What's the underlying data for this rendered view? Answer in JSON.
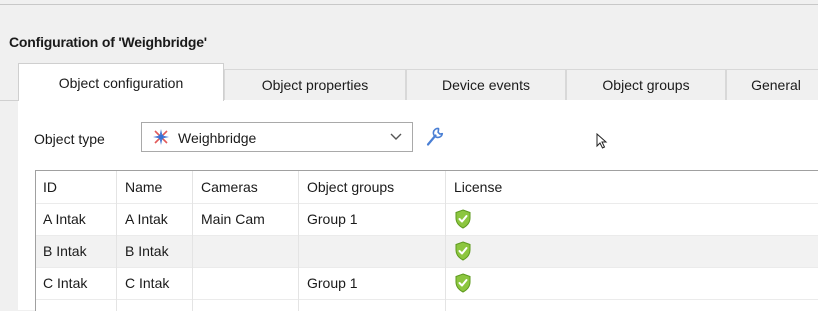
{
  "panel": {
    "title": "Configuration of 'Weighbridge'"
  },
  "tabs": [
    {
      "label": "Object configuration",
      "active": true
    },
    {
      "label": "Object properties",
      "active": false
    },
    {
      "label": "Device events",
      "active": false
    },
    {
      "label": "Object groups",
      "active": false
    },
    {
      "label": "General",
      "active": false
    }
  ],
  "object_type": {
    "label": "Object type",
    "value": "Weighbridge",
    "icon": "weighbridge-icon"
  },
  "grid": {
    "columns": [
      "ID",
      "Name",
      "Cameras",
      "Object groups",
      "License"
    ],
    "rows": [
      {
        "id": "A Intak",
        "name": "A Intak",
        "cameras": "Main Cam",
        "groups": "Group 1",
        "license": "licensed-shield-icon"
      },
      {
        "id": "B Intak",
        "name": "B Intak",
        "cameras": "",
        "groups": "",
        "license": "licensed-shield-icon"
      },
      {
        "id": "C Intak",
        "name": "C Intak",
        "cameras": "",
        "groups": "Group 1",
        "license": "licensed-shield-icon"
      }
    ]
  },
  "colors": {
    "shield": "#8cc63f",
    "wrench": "#4a7fd4"
  }
}
